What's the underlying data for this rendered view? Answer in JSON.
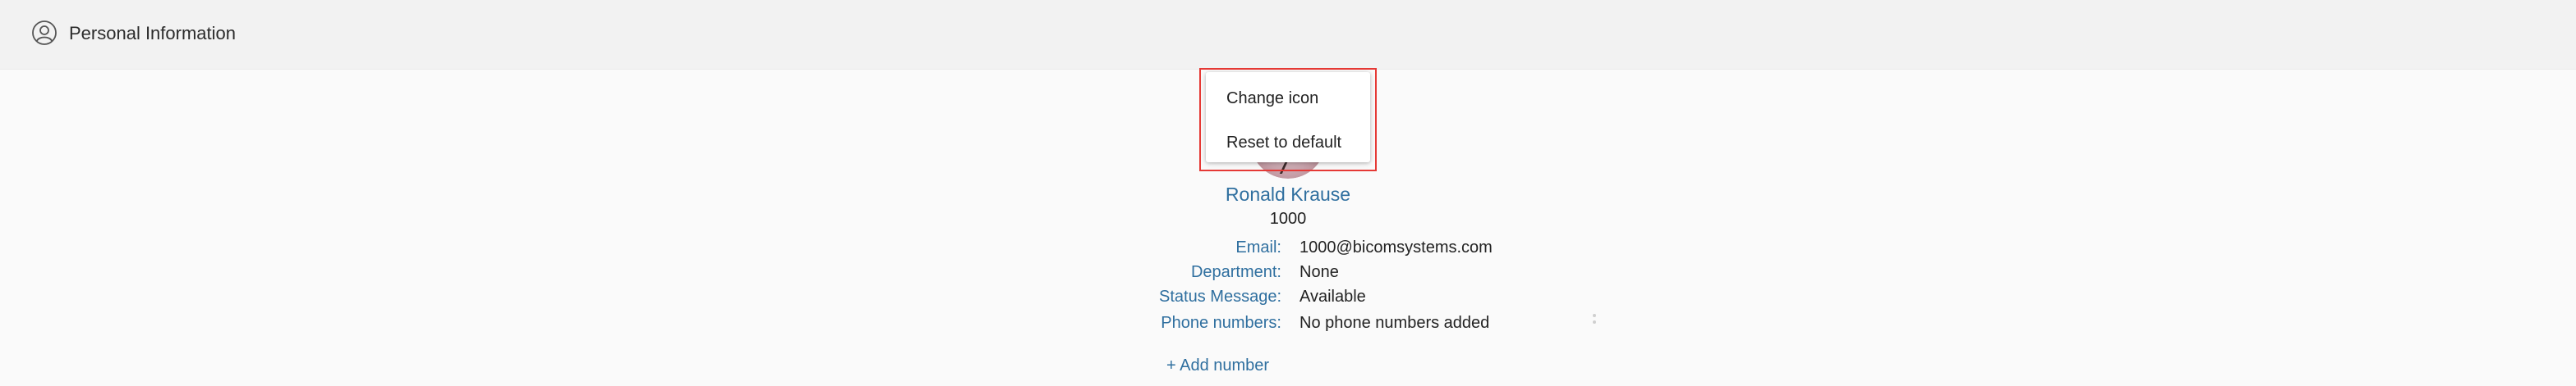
{
  "header": {
    "title": "Personal Information",
    "icon": "user-circle-icon"
  },
  "context_menu": {
    "items": [
      {
        "label": "Change icon"
      },
      {
        "label": "Reset to default"
      }
    ]
  },
  "profile": {
    "name": "Ronald Krause",
    "extension": "1000",
    "fields": {
      "email": {
        "label": "Email:",
        "value": "1000@bicomsystems.com"
      },
      "department": {
        "label": "Department:",
        "value": "None"
      },
      "status_message": {
        "label": "Status Message:",
        "value": "Available"
      },
      "phone_numbers": {
        "label": "Phone numbers:",
        "value": "No phone numbers added"
      }
    },
    "add_number_label": "+ Add number"
  },
  "colors": {
    "accent": "#2f6f9f",
    "highlight": "#e53935",
    "header_bg": "#f2f2f2",
    "page_bg": "#fafafa"
  }
}
